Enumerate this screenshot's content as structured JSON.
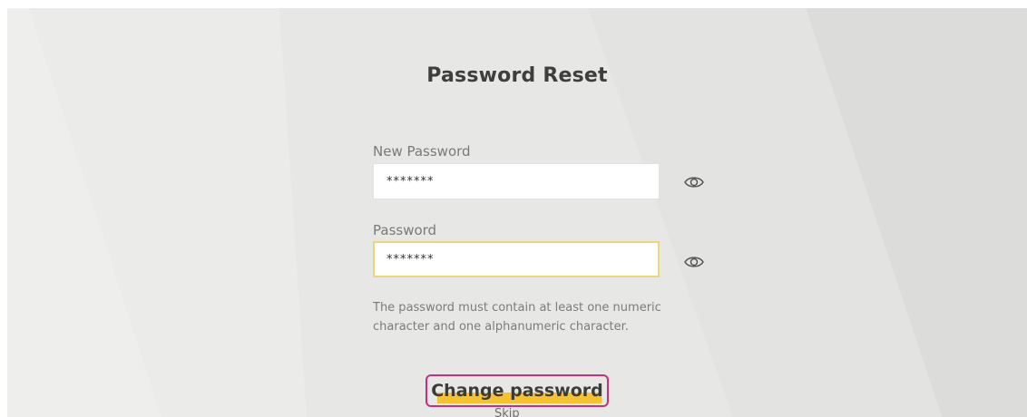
{
  "page": {
    "title": "Password Reset"
  },
  "form": {
    "new_password": {
      "label": "New Password",
      "value": "*******",
      "toggle_icon": "eye-icon"
    },
    "password": {
      "label": "Password",
      "value": "*******",
      "toggle_icon": "eye-icon"
    },
    "hint": "The password must contain at least one numeric character and one alphanumeric character.",
    "submit_label": "Change password",
    "skip_label": "Skip"
  },
  "colors": {
    "background": "#e7e7e6",
    "focus_border": "#ecd57c",
    "button_highlight": "#f6c232",
    "button_outline": "#c6307c",
    "title_text": "#3e3e3e"
  }
}
